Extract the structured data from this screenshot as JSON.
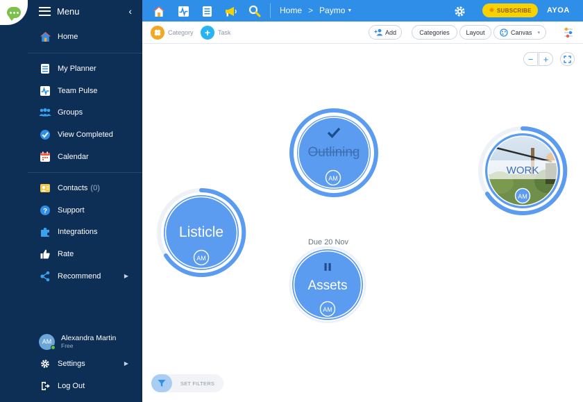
{
  "sidebar": {
    "menu_title": "Menu",
    "items": [
      {
        "label": "Home"
      },
      {
        "label": "My Planner"
      },
      {
        "label": "Team Pulse"
      },
      {
        "label": "Groups"
      },
      {
        "label": "View Completed"
      },
      {
        "label": "Calendar"
      },
      {
        "label": "Contacts",
        "count": "(0)"
      },
      {
        "label": "Support"
      },
      {
        "label": "Integrations"
      },
      {
        "label": "Rate"
      },
      {
        "label": "Recommend"
      }
    ],
    "user": {
      "name": "Alexandra Martin",
      "plan": "Free",
      "initials": "AM"
    },
    "settings_label": "Settings",
    "logout_label": "Log Out"
  },
  "topbar": {
    "breadcrumb_home": "Home",
    "breadcrumb_board": "Paymo",
    "subscribe_label": "SUBSCRIBE",
    "logo": "AYOA"
  },
  "toolbar": {
    "category_label": "Category",
    "task_label": "Task",
    "add_label": "Add",
    "categories_label": "Categories",
    "layout_label": "Layout",
    "canvas_label": "Canvas"
  },
  "canvas": {
    "filters_label": "SET FILTERS",
    "bubbles": [
      {
        "name": "Outlining",
        "initials": "AM",
        "status": "completed"
      },
      {
        "name": "WORK",
        "initials": "AM"
      },
      {
        "name": "Listicle",
        "initials": "AM"
      },
      {
        "name": "Assets",
        "initials": "AM",
        "status": "paused",
        "due": "Due 20 Nov"
      }
    ]
  },
  "colors": {
    "sidebar": "#0d2e55",
    "topbar": "#2f8ee8",
    "bubble_fill": "#5b9cf0",
    "bubble_ring": "#5b9cf0",
    "subscribe": "#f7d200"
  }
}
